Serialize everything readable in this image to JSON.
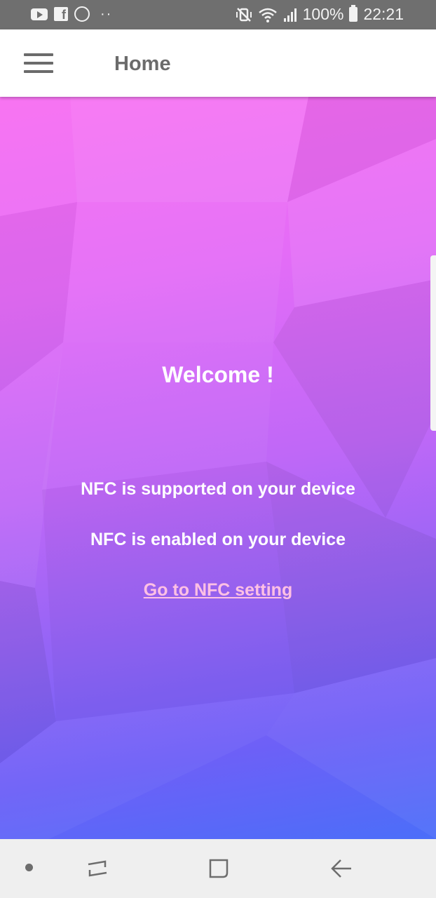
{
  "status_bar": {
    "left_icons": [
      "youtube-icon",
      "facebook-icon",
      "whatsapp-icon",
      "more-notifications-icon"
    ],
    "battery_text": "100%",
    "time": "22:21",
    "right_icons": [
      "vibrate-mute-icon",
      "wifi-icon",
      "signal-icon",
      "battery-icon"
    ]
  },
  "app_bar": {
    "title": "Home",
    "menu_icon": "hamburger-menu-icon"
  },
  "main": {
    "welcome": "Welcome !",
    "nfc_supported": "NFC is supported on your device",
    "nfc_enabled": "NFC is enabled on your device",
    "nfc_setting_link": "Go to NFC setting"
  },
  "nav_bar": {
    "buttons": [
      "recent-apps-icon",
      "home-icon",
      "back-icon"
    ]
  },
  "colors": {
    "gradient_top": "#f86cf2",
    "gradient_bottom": "#4b6ef9",
    "link": "#ffc0e4",
    "status_bar_bg": "#6f6f6f"
  }
}
